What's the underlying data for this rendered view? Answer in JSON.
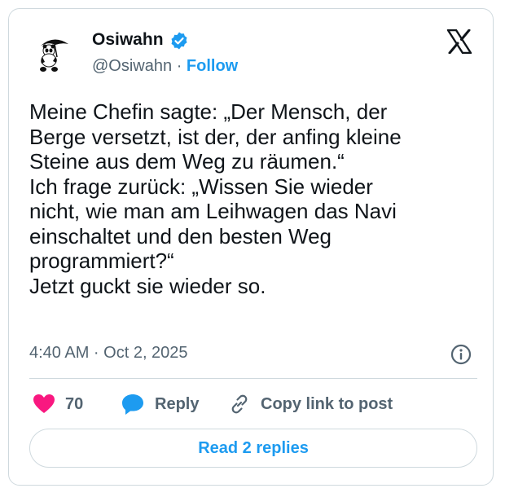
{
  "author": {
    "name": "Osiwahn",
    "handle": "@Osiwahn",
    "separator": "·",
    "follow_label": "Follow",
    "verified": true
  },
  "tweet": {
    "lines": [
      "Meine Chefin sagte: „Der Mensch, der",
      "Berge versetzt, ist der, der anfing kleine",
      "Steine aus dem Weg zu räumen.“",
      "Ich frage zurück: „Wissen Sie wieder",
      "nicht, wie man am Leihwagen das Navi",
      "einschaltet und den besten Weg",
      "programmiert?“",
      "Jetzt guckt sie wieder so."
    ],
    "timestamp": "4:40 AM · Oct 2, 2025"
  },
  "actions": {
    "like_count": "70",
    "reply_label": "Reply",
    "copy_label": "Copy link to post"
  },
  "replies_button": "Read 2 replies",
  "colors": {
    "accent": "#1d9bf0",
    "like": "#f91880",
    "text": "#0f1419",
    "muted": "#536471",
    "border": "#cfd9de"
  },
  "icons": [
    "panda-avatar-icon",
    "verified-badge-icon",
    "x-logo-icon",
    "info-icon",
    "heart-icon",
    "reply-bubble-icon",
    "link-icon"
  ]
}
